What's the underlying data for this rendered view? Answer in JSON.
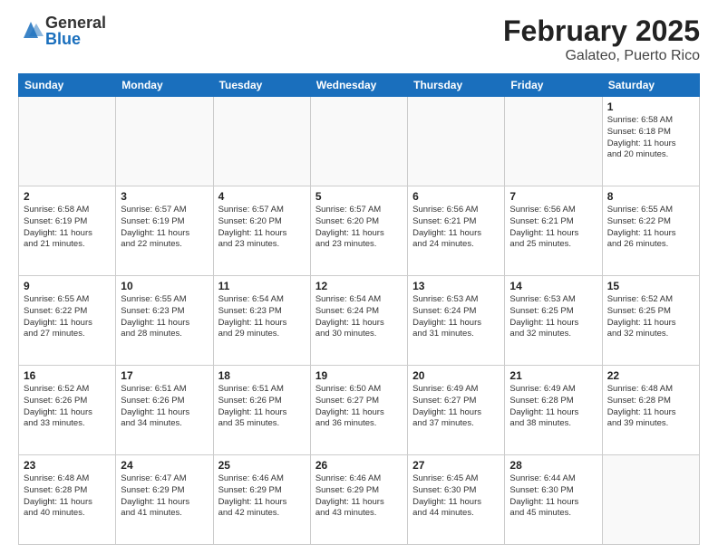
{
  "header": {
    "logo_general": "General",
    "logo_blue": "Blue",
    "title": "February 2025",
    "location": "Galateo, Puerto Rico"
  },
  "weekdays": [
    "Sunday",
    "Monday",
    "Tuesday",
    "Wednesday",
    "Thursday",
    "Friday",
    "Saturday"
  ],
  "weeks": [
    [
      {
        "day": "",
        "info": ""
      },
      {
        "day": "",
        "info": ""
      },
      {
        "day": "",
        "info": ""
      },
      {
        "day": "",
        "info": ""
      },
      {
        "day": "",
        "info": ""
      },
      {
        "day": "",
        "info": ""
      },
      {
        "day": "1",
        "info": "Sunrise: 6:58 AM\nSunset: 6:18 PM\nDaylight: 11 hours\nand 20 minutes."
      }
    ],
    [
      {
        "day": "2",
        "info": "Sunrise: 6:58 AM\nSunset: 6:19 PM\nDaylight: 11 hours\nand 21 minutes."
      },
      {
        "day": "3",
        "info": "Sunrise: 6:57 AM\nSunset: 6:19 PM\nDaylight: 11 hours\nand 22 minutes."
      },
      {
        "day": "4",
        "info": "Sunrise: 6:57 AM\nSunset: 6:20 PM\nDaylight: 11 hours\nand 23 minutes."
      },
      {
        "day": "5",
        "info": "Sunrise: 6:57 AM\nSunset: 6:20 PM\nDaylight: 11 hours\nand 23 minutes."
      },
      {
        "day": "6",
        "info": "Sunrise: 6:56 AM\nSunset: 6:21 PM\nDaylight: 11 hours\nand 24 minutes."
      },
      {
        "day": "7",
        "info": "Sunrise: 6:56 AM\nSunset: 6:21 PM\nDaylight: 11 hours\nand 25 minutes."
      },
      {
        "day": "8",
        "info": "Sunrise: 6:55 AM\nSunset: 6:22 PM\nDaylight: 11 hours\nand 26 minutes."
      }
    ],
    [
      {
        "day": "9",
        "info": "Sunrise: 6:55 AM\nSunset: 6:22 PM\nDaylight: 11 hours\nand 27 minutes."
      },
      {
        "day": "10",
        "info": "Sunrise: 6:55 AM\nSunset: 6:23 PM\nDaylight: 11 hours\nand 28 minutes."
      },
      {
        "day": "11",
        "info": "Sunrise: 6:54 AM\nSunset: 6:23 PM\nDaylight: 11 hours\nand 29 minutes."
      },
      {
        "day": "12",
        "info": "Sunrise: 6:54 AM\nSunset: 6:24 PM\nDaylight: 11 hours\nand 30 minutes."
      },
      {
        "day": "13",
        "info": "Sunrise: 6:53 AM\nSunset: 6:24 PM\nDaylight: 11 hours\nand 31 minutes."
      },
      {
        "day": "14",
        "info": "Sunrise: 6:53 AM\nSunset: 6:25 PM\nDaylight: 11 hours\nand 32 minutes."
      },
      {
        "day": "15",
        "info": "Sunrise: 6:52 AM\nSunset: 6:25 PM\nDaylight: 11 hours\nand 32 minutes."
      }
    ],
    [
      {
        "day": "16",
        "info": "Sunrise: 6:52 AM\nSunset: 6:26 PM\nDaylight: 11 hours\nand 33 minutes."
      },
      {
        "day": "17",
        "info": "Sunrise: 6:51 AM\nSunset: 6:26 PM\nDaylight: 11 hours\nand 34 minutes."
      },
      {
        "day": "18",
        "info": "Sunrise: 6:51 AM\nSunset: 6:26 PM\nDaylight: 11 hours\nand 35 minutes."
      },
      {
        "day": "19",
        "info": "Sunrise: 6:50 AM\nSunset: 6:27 PM\nDaylight: 11 hours\nand 36 minutes."
      },
      {
        "day": "20",
        "info": "Sunrise: 6:49 AM\nSunset: 6:27 PM\nDaylight: 11 hours\nand 37 minutes."
      },
      {
        "day": "21",
        "info": "Sunrise: 6:49 AM\nSunset: 6:28 PM\nDaylight: 11 hours\nand 38 minutes."
      },
      {
        "day": "22",
        "info": "Sunrise: 6:48 AM\nSunset: 6:28 PM\nDaylight: 11 hours\nand 39 minutes."
      }
    ],
    [
      {
        "day": "23",
        "info": "Sunrise: 6:48 AM\nSunset: 6:28 PM\nDaylight: 11 hours\nand 40 minutes."
      },
      {
        "day": "24",
        "info": "Sunrise: 6:47 AM\nSunset: 6:29 PM\nDaylight: 11 hours\nand 41 minutes."
      },
      {
        "day": "25",
        "info": "Sunrise: 6:46 AM\nSunset: 6:29 PM\nDaylight: 11 hours\nand 42 minutes."
      },
      {
        "day": "26",
        "info": "Sunrise: 6:46 AM\nSunset: 6:29 PM\nDaylight: 11 hours\nand 43 minutes."
      },
      {
        "day": "27",
        "info": "Sunrise: 6:45 AM\nSunset: 6:30 PM\nDaylight: 11 hours\nand 44 minutes."
      },
      {
        "day": "28",
        "info": "Sunrise: 6:44 AM\nSunset: 6:30 PM\nDaylight: 11 hours\nand 45 minutes."
      },
      {
        "day": "",
        "info": ""
      }
    ]
  ]
}
